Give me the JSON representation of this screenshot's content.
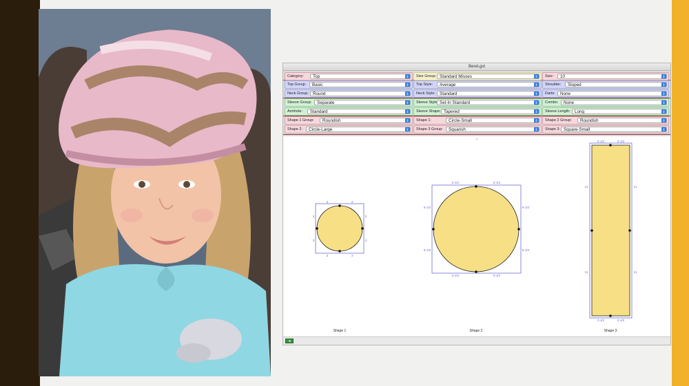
{
  "window": {
    "title": "Beret.gst"
  },
  "rows": [
    [
      {
        "label": "Category:",
        "value": "Top",
        "color": "red"
      },
      {
        "label": "Size Group:",
        "value": "Standard Misses",
        "color": "yellow"
      },
      {
        "label": "Size:",
        "value": "10",
        "color": "red"
      }
    ],
    [
      {
        "label": "Top Group:",
        "value": "Basic",
        "color": "blue"
      },
      {
        "label": "Top Style:",
        "value": "Average",
        "color": "blue"
      },
      {
        "label": "Shoulder:",
        "value": "Sloped",
        "color": "blue"
      }
    ],
    [
      {
        "label": "Neck Group:",
        "value": "Round",
        "color": "blue"
      },
      {
        "label": "Neck Style:",
        "value": "Standard",
        "color": "blue"
      },
      {
        "label": "Darts:",
        "value": "None",
        "color": "blue"
      }
    ],
    [
      {
        "label": "Sleeve Group:",
        "value": "Separate",
        "color": "green"
      },
      {
        "label": "Sleeve Style:",
        "value": "Set-In Standard",
        "color": "green"
      },
      {
        "label": "Combo:",
        "value": "None",
        "color": "green"
      }
    ],
    [
      {
        "label": "Armhole:",
        "value": "Standard",
        "color": "green"
      },
      {
        "label": "Sleeve Shape:",
        "value": "Tapered",
        "color": "green"
      },
      {
        "label": "Sleeve Length:",
        "value": "Long",
        "color": "green"
      }
    ],
    [
      {
        "label": "Shape 1 Group:",
        "value": "Roundish",
        "color": "red"
      },
      {
        "label": "Shape 1:",
        "value": "Circle-Small",
        "color": "red"
      },
      {
        "label": "Shape 2 Group:",
        "value": "Roundish",
        "color": "red"
      }
    ],
    [
      {
        "label": "Shape 2:",
        "value": "Circle-Large",
        "color": "red"
      },
      {
        "label": "Shape 3 Group:",
        "value": "Squarish",
        "color": "red"
      },
      {
        "label": "Shape 3:",
        "value": "Square-Small",
        "color": "red"
      }
    ]
  ],
  "shapes": {
    "shape1": {
      "label": "Shape 1",
      "dim": "3"
    },
    "shape2": {
      "label": "Shape 2",
      "dim": "5-1/2"
    },
    "shape3": {
      "label": "Shape 3",
      "width_dim": "2-1/2",
      "height_dim": "11"
    }
  },
  "colors": {
    "fill": "#f7df86",
    "dimension": "#6a6ad8",
    "left_bar": "#2a1d0c",
    "right_bar": "#f2b12b"
  },
  "photo": {
    "description_icon": "girl-wearing-beret-photo"
  }
}
